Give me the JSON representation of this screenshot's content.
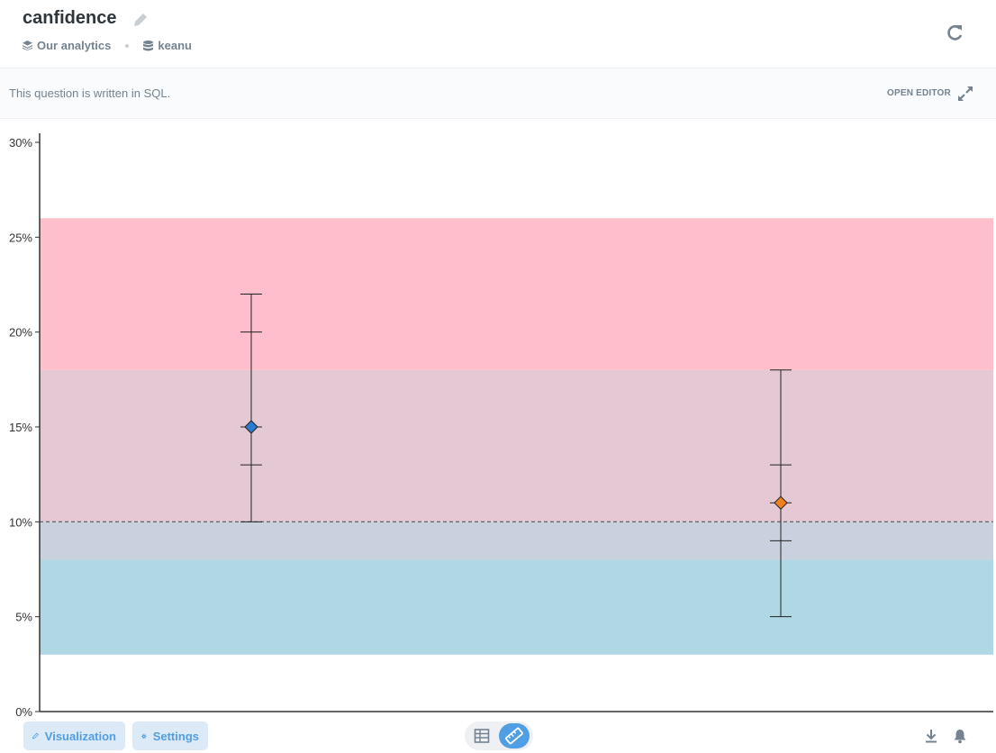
{
  "header": {
    "title": "canfidence",
    "collection": "Our analytics",
    "database": "keanu"
  },
  "sqlbar": {
    "message": "This question is written in SQL.",
    "open_editor": "OPEN EDITOR"
  },
  "footer": {
    "visualization_label": "Visualization",
    "settings_label": "Settings"
  },
  "chart_data": {
    "type": "scatter",
    "y_ticks": [
      "30%",
      "25%",
      "20%",
      "15%",
      "10%",
      "5%",
      "0%"
    ],
    "ylim": [
      0,
      30
    ],
    "reference_line": 10,
    "bands": [
      {
        "from": 18,
        "to": 26,
        "color": "#ffbecb"
      },
      {
        "from": 10,
        "to": 18,
        "color": "#e4c9d4"
      },
      {
        "from": 8,
        "to": 10,
        "color": "#c9d1de"
      },
      {
        "from": 3,
        "to": 8,
        "color": "#afd8e4"
      }
    ],
    "points": [
      {
        "value": 15,
        "low": 10,
        "high": 22,
        "inner_low": 13,
        "inner_high": 20,
        "color": "#2c7bcf"
      },
      {
        "value": 11,
        "low": 5,
        "high": 18,
        "inner_low": 9,
        "inner_high": 13,
        "color": "#f2811d"
      }
    ],
    "grid": false
  }
}
